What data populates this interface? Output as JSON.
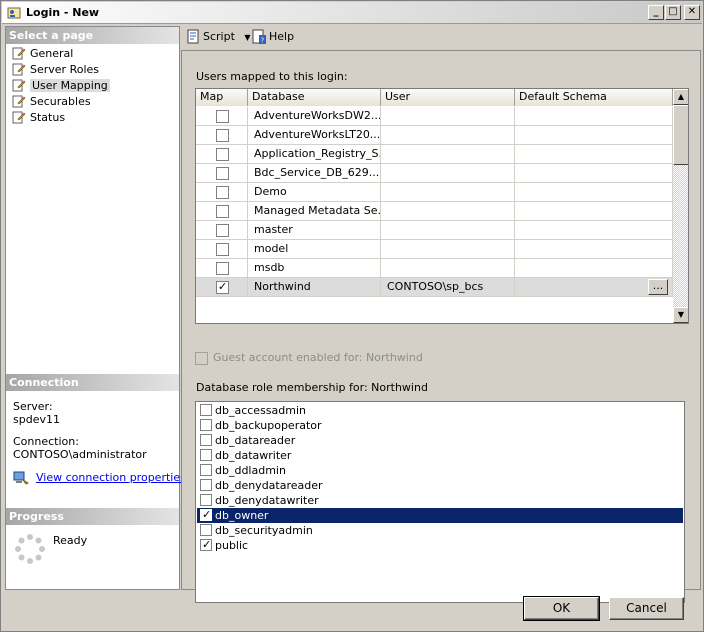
{
  "window": {
    "title": "Login - New",
    "controls": [
      "minimize",
      "maximize",
      "close"
    ]
  },
  "sidebar": {
    "select_page_header": "Select a page",
    "pages": [
      {
        "label": "General",
        "icon": "page-wrench-icon",
        "selected": false
      },
      {
        "label": "Server Roles",
        "icon": "page-wrench-icon",
        "selected": false
      },
      {
        "label": "User Mapping",
        "icon": "page-wrench-icon",
        "selected": true
      },
      {
        "label": "Securables",
        "icon": "page-wrench-icon",
        "selected": false
      },
      {
        "label": "Status",
        "icon": "page-wrench-icon",
        "selected": false
      }
    ],
    "connection_header": "Connection",
    "server_label": "Server:",
    "server_value": "spdev11",
    "connection_label": "Connection:",
    "connection_value": "CONTOSO\\administrator",
    "view_connection_link": "View connection properties",
    "progress_header": "Progress",
    "progress_status": "Ready"
  },
  "toolbar": {
    "script_label": "Script",
    "help_label": "Help"
  },
  "mapping": {
    "section_label": "Users mapped to this login:",
    "columns": {
      "map": "Map",
      "database": "Database",
      "user": "User",
      "schema": "Default Schema"
    },
    "rows": [
      {
        "map": false,
        "database": "AdventureWorksDW2...",
        "user": "",
        "schema": ""
      },
      {
        "map": false,
        "database": "AdventureWorksLT20...",
        "user": "",
        "schema": ""
      },
      {
        "map": false,
        "database": "Application_Registry_S...",
        "user": "",
        "schema": ""
      },
      {
        "map": false,
        "database": "Bdc_Service_DB_629...",
        "user": "",
        "schema": ""
      },
      {
        "map": false,
        "database": "Demo",
        "user": "",
        "schema": ""
      },
      {
        "map": false,
        "database": "Managed Metadata Se...",
        "user": "",
        "schema": ""
      },
      {
        "map": false,
        "database": "master",
        "user": "",
        "schema": ""
      },
      {
        "map": false,
        "database": "model",
        "user": "",
        "schema": ""
      },
      {
        "map": false,
        "database": "msdb",
        "user": "",
        "schema": ""
      },
      {
        "map": true,
        "database": "Northwind",
        "user": "CONTOSO\\sp_bcs",
        "schema": ""
      }
    ],
    "ellipsis_label": "..."
  },
  "guest": {
    "label": "Guest account enabled for: Northwind",
    "checked": false
  },
  "roles": {
    "section_label": "Database role membership for: Northwind",
    "items": [
      {
        "label": "db_accessadmin",
        "checked": false,
        "selected": false
      },
      {
        "label": "db_backupoperator",
        "checked": false,
        "selected": false
      },
      {
        "label": "db_datareader",
        "checked": false,
        "selected": false
      },
      {
        "label": "db_datawriter",
        "checked": false,
        "selected": false
      },
      {
        "label": "db_ddladmin",
        "checked": false,
        "selected": false
      },
      {
        "label": "db_denydatareader",
        "checked": false,
        "selected": false
      },
      {
        "label": "db_denydatawriter",
        "checked": false,
        "selected": false
      },
      {
        "label": "db_owner",
        "checked": true,
        "selected": true
      },
      {
        "label": "db_securityadmin",
        "checked": false,
        "selected": false
      },
      {
        "label": "public",
        "checked": true,
        "selected": false
      }
    ]
  },
  "footer": {
    "ok_label": "OK",
    "cancel_label": "Cancel"
  }
}
